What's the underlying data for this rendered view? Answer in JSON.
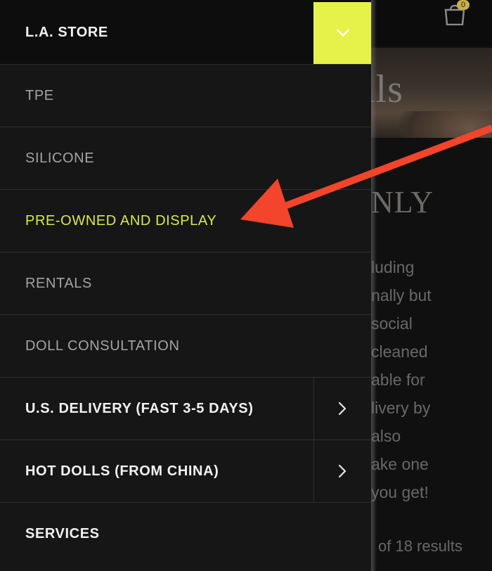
{
  "background": {
    "cart_count": "0",
    "hero_title": "lls",
    "section_title": "NLY",
    "paragraph_lines": [
      "luding",
      "nally but",
      "social",
      "cleaned",
      "able for",
      "livery by",
      "also",
      "ake one",
      "you get!"
    ],
    "results_text": "of 18 results"
  },
  "drawer": {
    "header": {
      "label": "L.A. STORE",
      "toggle_icon": "chevron-down-icon"
    },
    "subitems": [
      {
        "label": "TPE"
      },
      {
        "label": "SILICONE"
      },
      {
        "label": "PRE-OWNED AND DISPLAY",
        "active": true
      },
      {
        "label": "RENTALS"
      },
      {
        "label": "DOLL CONSULTATION"
      }
    ],
    "main_items": [
      {
        "label": "U.S. DELIVERY (FAST 3-5 DAYS)",
        "icon": "chevron-right-icon"
      },
      {
        "label": "HOT DOLLS (FROM CHINA)",
        "icon": "chevron-right-icon"
      },
      {
        "label": "SERVICES"
      }
    ]
  },
  "colors": {
    "accent": "#e6f24a",
    "active_text": "#d8ea4e",
    "annotation_arrow": "#f2452b"
  }
}
